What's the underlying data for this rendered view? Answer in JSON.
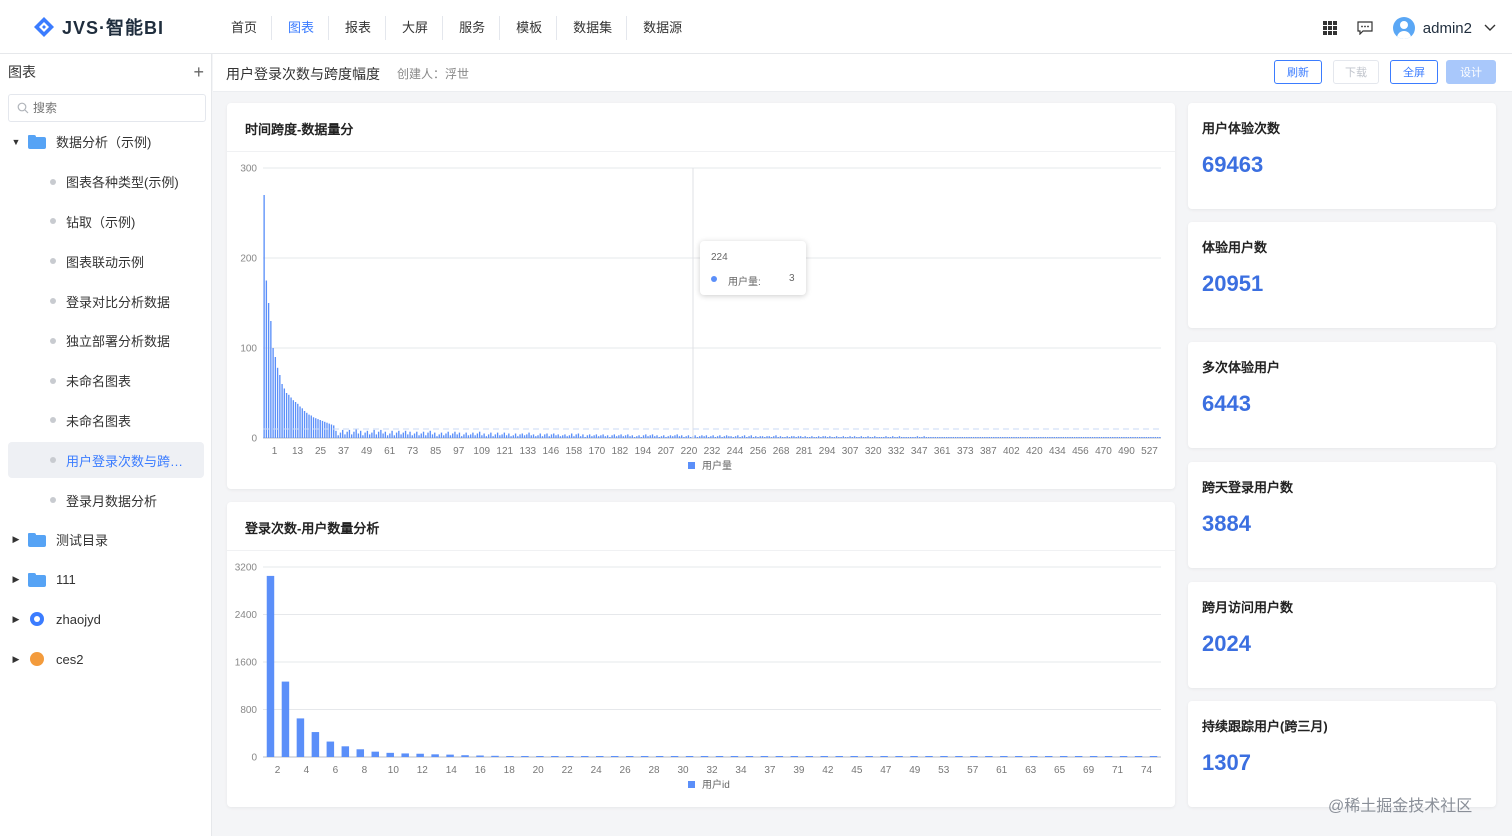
{
  "app": {
    "logo_text": "JVS·智能BI",
    "user": "admin2"
  },
  "nav": [
    "首页",
    "图表",
    "报表",
    "大屏",
    "服务",
    "模板",
    "数据集",
    "数据源"
  ],
  "nav_active": 1,
  "sidebar": {
    "title": "图表",
    "add_symbol": "+",
    "search_placeholder": "搜索",
    "tree": [
      {
        "type": "folder",
        "label": "数据分析（示例)",
        "expanded": true
      },
      {
        "type": "leaf",
        "label": "图表各种类型(示例)"
      },
      {
        "type": "leaf",
        "label": "钻取（示例)"
      },
      {
        "type": "leaf",
        "label": "图表联动示例"
      },
      {
        "type": "leaf",
        "label": "登录对比分析数据"
      },
      {
        "type": "leaf",
        "label": "独立部署分析数据"
      },
      {
        "type": "leaf",
        "label": "未命名图表"
      },
      {
        "type": "leaf",
        "label": "未命名图表"
      },
      {
        "type": "leaf",
        "label": "用户登录次数与跨度幅度",
        "active": true
      },
      {
        "type": "leaf",
        "label": "登录月数据分析"
      },
      {
        "type": "folder",
        "label": "测试目录"
      },
      {
        "type": "folder",
        "label": "111"
      },
      {
        "type": "app-blue",
        "label": "zhaojyd"
      },
      {
        "type": "app-orange",
        "label": "ces2"
      }
    ]
  },
  "page": {
    "title": "用户登录次数与跨度幅度",
    "creator": "创建人：浮世",
    "buttons": {
      "refresh": "刷新",
      "download": "下载",
      "fullscreen": "全屏",
      "design": "设计"
    }
  },
  "stats": [
    {
      "label": "用户体验次数",
      "value": "69463"
    },
    {
      "label": "体验用户数",
      "value": "20951"
    },
    {
      "label": "多次体验用户",
      "value": "6443"
    },
    {
      "label": "跨天登录用户数",
      "value": "3884"
    },
    {
      "label": "跨月访问用户数",
      "value": "2024"
    },
    {
      "label": "持续跟踪用户(跨三月)",
      "value": "1307"
    }
  ],
  "chart_data": [
    {
      "type": "bar",
      "title": "时间跨度-数据量分",
      "legend": "用户量",
      "legend_position": "bottom",
      "ylim": [
        0,
        300
      ],
      "y_ticks": [
        0,
        100,
        200,
        300
      ],
      "x_tick_labels": [
        "1",
        "13",
        "25",
        "37",
        "49",
        "61",
        "73",
        "85",
        "97",
        "109",
        "121",
        "133",
        "146",
        "158",
        "170",
        "182",
        "194",
        "207",
        "220",
        "232",
        "244",
        "256",
        "268",
        "281",
        "294",
        "307",
        "320",
        "332",
        "347",
        "361",
        "373",
        "387",
        "402",
        "420",
        "434",
        "456",
        "470",
        "490",
        "527"
      ],
      "series": [
        {
          "name": "用户量",
          "head_values": [
            270,
            175,
            150,
            130,
            100,
            90,
            78,
            70,
            60,
            55,
            50,
            48,
            45,
            42,
            40,
            38,
            35,
            33,
            30,
            28,
            26,
            25,
            23,
            22,
            21,
            20,
            19,
            18,
            17,
            16,
            15,
            14
          ],
          "tail_typical": 8,
          "approx_bar_count": 400
        }
      ],
      "tooltip": {
        "x": "224",
        "name": "用户量:",
        "value": "3"
      },
      "grid": true
    },
    {
      "type": "bar",
      "title": "登录次数-用户数量分析",
      "legend": "用户id",
      "legend_position": "bottom",
      "ylim": [
        0,
        3200
      ],
      "y_ticks": [
        0,
        800,
        1600,
        2400,
        3200
      ],
      "categories": [
        "2",
        "4",
        "6",
        "8",
        "10",
        "12",
        "14",
        "16",
        "18",
        "20",
        "22",
        "24",
        "26",
        "28",
        "30",
        "32",
        "34",
        "37",
        "39",
        "42",
        "45",
        "47",
        "49",
        "53",
        "57",
        "61",
        "63",
        "65",
        "69",
        "71",
        "74"
      ],
      "x_tick_labels": [
        "2",
        "4",
        "6",
        "8",
        "10",
        "12",
        "14",
        "16",
        "18",
        "20",
        "22",
        "24",
        "26",
        "28",
        "30",
        "32",
        "34",
        "37",
        "39",
        "42",
        "45",
        "47",
        "49",
        "53",
        "57",
        "61",
        "63",
        "65",
        "69",
        "71",
        "74"
      ],
      "series": [
        {
          "name": "用户id",
          "values": [
            3050,
            1270,
            650,
            420,
            260,
            180,
            130,
            90,
            70,
            60,
            55,
            45,
            40,
            30,
            25,
            20,
            15,
            12,
            10,
            8,
            6,
            5,
            4,
            3,
            3,
            2,
            2,
            2,
            1,
            1,
            1,
            1,
            1,
            1,
            1,
            1,
            1,
            1,
            1,
            1,
            1,
            1,
            1,
            1,
            1,
            1,
            1,
            1,
            1,
            1,
            1,
            1,
            1,
            1,
            1,
            1,
            1,
            1,
            1,
            1
          ]
        }
      ],
      "grid": true
    }
  ],
  "watermark": "@稀土掘金技术社区",
  "colors": {
    "accent": "#3b7cff",
    "bar": "#5b8ff9",
    "stat_value": "#3b6fe0"
  }
}
